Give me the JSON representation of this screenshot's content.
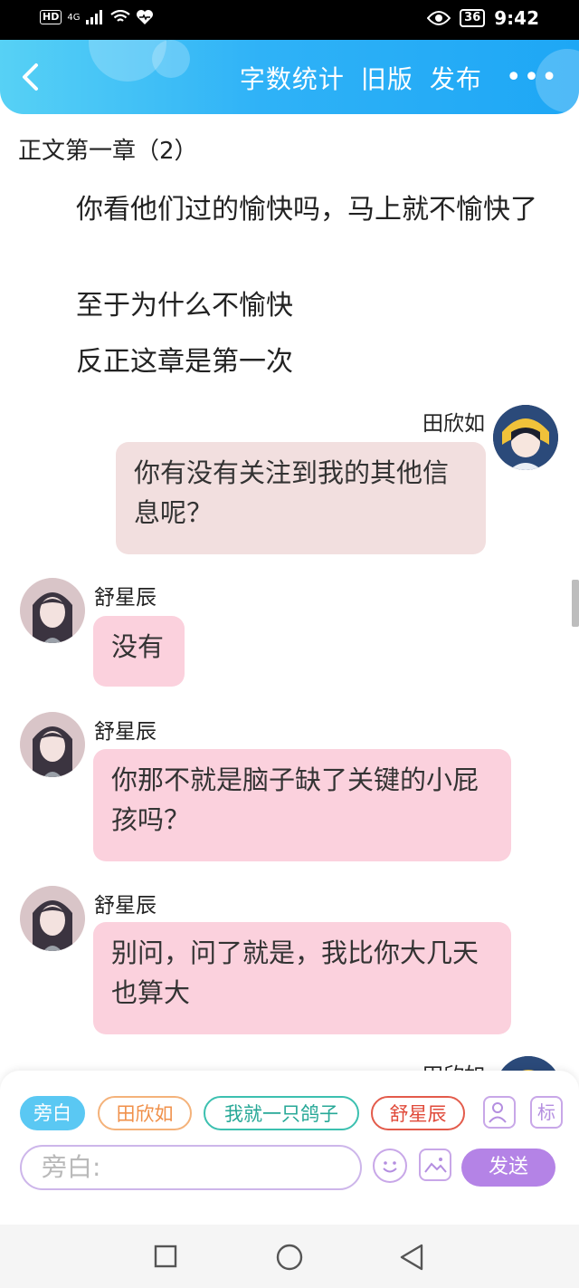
{
  "status_bar": {
    "hd": "HD",
    "network": "4G",
    "battery": "36",
    "time": "9:42"
  },
  "header": {
    "word_count": "字数统计",
    "old_version": "旧版",
    "publish": "发布",
    "more": "•••"
  },
  "chapter": {
    "title": "正文第一章（2）",
    "paragraphs": [
      "你看他们过的愉快吗，马上就不愉快了",
      "至于为什么不愉快",
      "反正这章是第一次"
    ]
  },
  "messages": [
    {
      "side": "right",
      "name": "田欣如",
      "text": "你有没有关注到我的其他信息呢？"
    },
    {
      "side": "left",
      "name": "舒星辰",
      "text": "没有"
    },
    {
      "side": "left",
      "name": "舒星辰",
      "text": "你那不就是脑子缺了关键的小屁孩吗？"
    },
    {
      "side": "left",
      "name": "舒星辰",
      "text": "别问，问了就是，我比你大几天也算大"
    },
    {
      "side": "right",
      "name": "田欣如",
      "text": ""
    }
  ],
  "input_panel": {
    "role_chips": [
      "旁白",
      "田欣如",
      "我就一只鸽子",
      "舒星辰"
    ],
    "tag_button": "标",
    "placeholder": "旁白:",
    "send_label": "发送"
  },
  "colors": {
    "header_accent": "#2fb2f7",
    "my_bubble": "#f2dfdf",
    "their_bubble": "#fbd1dd",
    "send": "#b483e6"
  }
}
